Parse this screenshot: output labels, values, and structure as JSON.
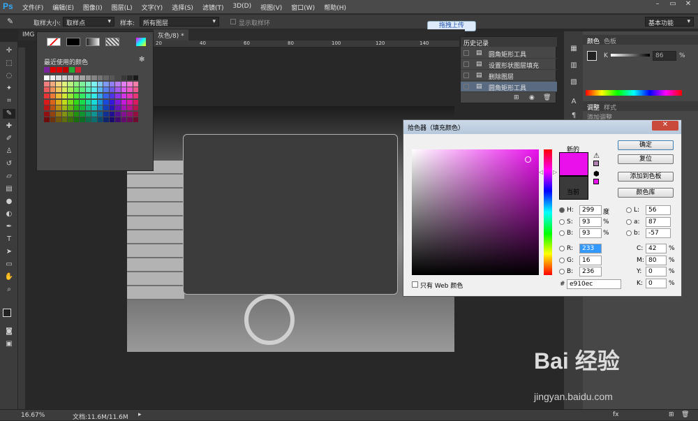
{
  "menu": {
    "logo": "Ps",
    "items": [
      "文件(F)",
      "编辑(E)",
      "图像(I)",
      "图层(L)",
      "文字(Y)",
      "选择(S)",
      "滤镜(T)",
      "3D(D)",
      "视图(V)",
      "窗口(W)",
      "帮助(H)"
    ]
  },
  "options": {
    "sample_size_label": "取样大小:",
    "sample_size_value": "取样点",
    "sample_label": "样本:",
    "sample_value": "所有图层",
    "show_ring": "显示取样环",
    "workspace": "基本功能"
  },
  "upload_button": "拖拽上传",
  "document": {
    "tab_prefix": "IMG",
    "tab_title": "灰色/8) *",
    "ruler_ticks": [
      "20",
      "40",
      "60",
      "80",
      "100",
      "120",
      "140"
    ]
  },
  "swatches": {
    "recent_label": "最近使用的颜色",
    "recent": [
      "#7a22a0",
      "#e00000",
      "#e00000",
      "#c00000",
      "#22aa33",
      "#cc2233"
    ]
  },
  "history": {
    "title": "历史记录",
    "items": [
      "圆角矩形工具",
      "设置形状图层填充",
      "删除图层",
      "圆角矩形工具"
    ]
  },
  "color_panel": {
    "tabs": [
      "颜色",
      "色板"
    ],
    "k_label": "K",
    "k_value": "86",
    "k_unit": "%",
    "adjust_tabs": [
      "调整",
      "样式"
    ],
    "adjust_title": "添加调整"
  },
  "picker": {
    "title": "拾色器（填充颜色）",
    "new_label": "新的",
    "current_label": "当前",
    "buttons": {
      "ok": "确定",
      "reset": "复位",
      "add_swatch": "添加到色板",
      "libraries": "颜色库"
    },
    "hsb": {
      "H": "299",
      "H_unit": "度",
      "S": "93",
      "S_unit": "%",
      "B": "93",
      "B_unit": "%"
    },
    "rgb": {
      "R": "233",
      "G": "16",
      "B": "236"
    },
    "lab": {
      "L": "56",
      "a": "87",
      "b": "-57"
    },
    "cmyk": {
      "C": "42",
      "M": "80",
      "Y": "0",
      "K": "0",
      "unit": "%"
    },
    "hex_label": "#",
    "hex": "e910ec",
    "web_only_label": "只有 Web 颜色",
    "new_color": "#e910ec",
    "current_color": "#3a3a3a"
  },
  "status": {
    "zoom": "16.67%",
    "doc": "文档:11.6M/11.6M"
  },
  "watermark": {
    "brand": "Bai  经验",
    "url": "jingyan.baidu.com"
  }
}
